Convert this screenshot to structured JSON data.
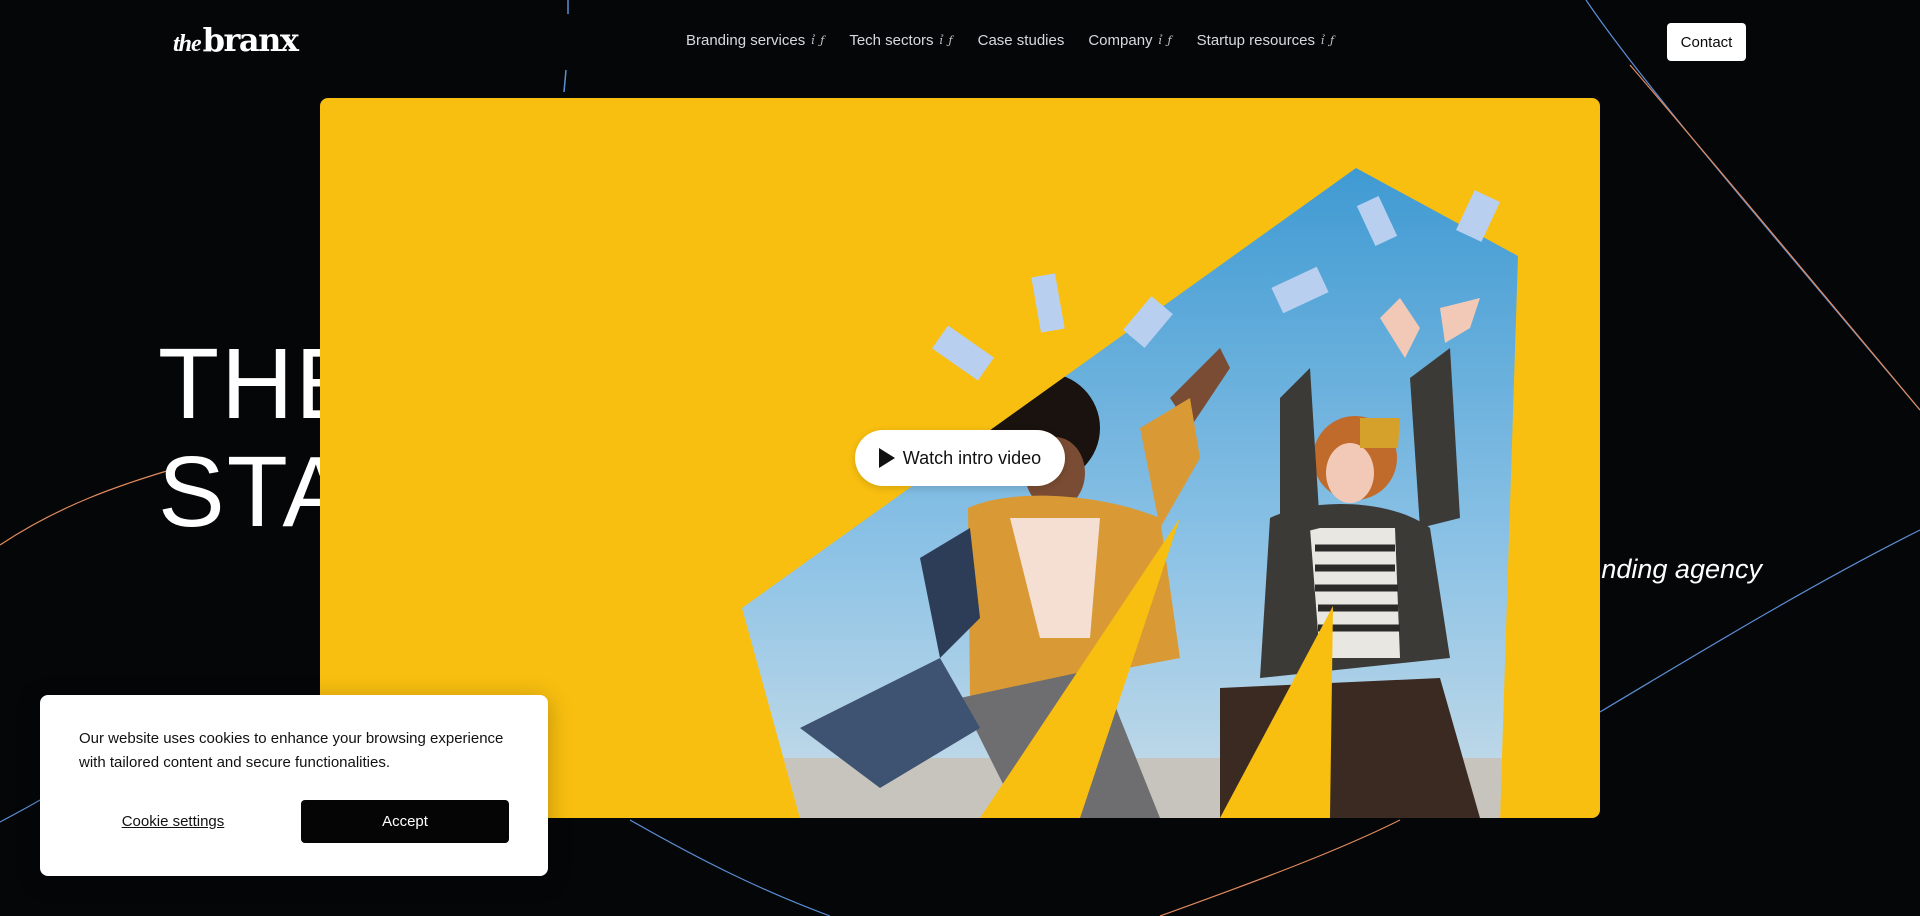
{
  "brand": {
    "logo_prefix": "the",
    "logo_word": "branx"
  },
  "nav": {
    "items": [
      {
        "label": "Branding services",
        "has_dropdown": true
      },
      {
        "label": "Tech sectors",
        "has_dropdown": true
      },
      {
        "label": "Case studies",
        "has_dropdown": false
      },
      {
        "label": "Company",
        "has_dropdown": true
      },
      {
        "label": "Startup resources",
        "has_dropdown": true
      }
    ],
    "dropdown_glyph": "ỉ ƒ",
    "contact_label": "Contact"
  },
  "hero": {
    "title_visible": "THE\nSTA",
    "subtitle_visible": "nding agency"
  },
  "video": {
    "play_label": "Watch intro video",
    "play_icon": "play-icon",
    "background_color": "#f8bf10"
  },
  "cookie": {
    "message": "Our website uses cookies to enhance your browsing experience with tailored content and secure functionalities.",
    "settings_label": "Cookie settings",
    "accept_label": "Accept"
  },
  "colors": {
    "page_bg": "#050608",
    "accent_yellow": "#f8bf10",
    "line_blue": "#5b8fd6",
    "line_orange": "#e08a5c"
  }
}
